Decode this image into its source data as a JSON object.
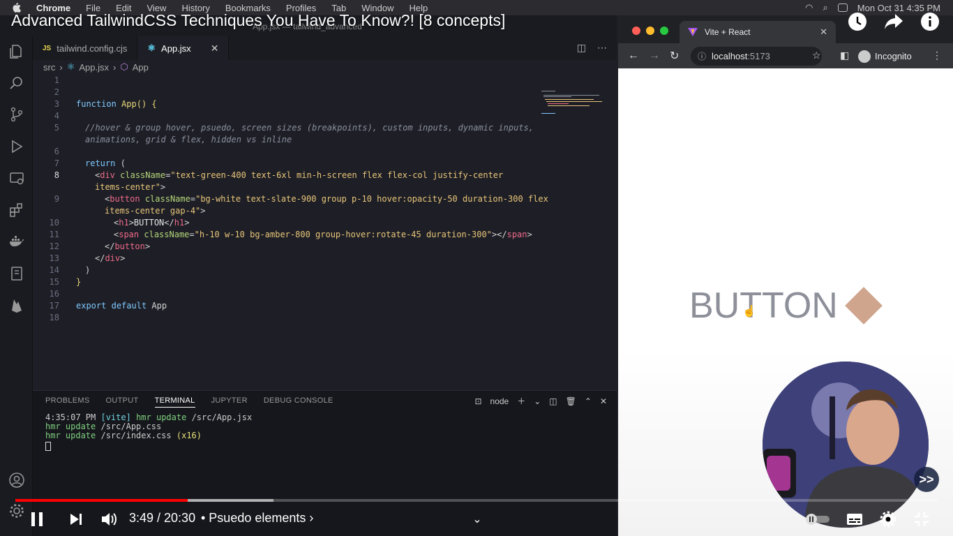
{
  "menubar": {
    "app": "Chrome",
    "items": [
      "File",
      "Edit",
      "View",
      "History",
      "Bookmarks",
      "Profiles",
      "Tab",
      "Window",
      "Help"
    ],
    "clock": "Mon Oct 31  4:35 PM"
  },
  "video": {
    "title": "Advanced TailwindCSS Techniques You Have To Know?! [8 concepts]",
    "time": "3:49 / 20:30",
    "chapter": "• Psuedo elements ›",
    "progress_played": 0.187,
    "progress_buffered": 0.28,
    "skip_label": ">>"
  },
  "vscode": {
    "window_title": "App.jsx — tailwind_advanced",
    "tabs": [
      {
        "label": "tailwind.config.cjs",
        "icon": "JS"
      },
      {
        "label": "App.jsx",
        "icon": "⚛"
      }
    ],
    "breadcrumb": {
      "src": "src",
      "file": "App.jsx",
      "symbol": "App"
    },
    "line_numbers": [
      "1",
      "2",
      "3",
      "4",
      "5",
      "",
      "6",
      "7",
      "8",
      "",
      "9",
      "",
      "10",
      "11",
      "12",
      "13",
      "14",
      "15",
      "16",
      "17",
      "18"
    ],
    "panel_tabs": [
      "PROBLEMS",
      "OUTPUT",
      "TERMINAL",
      "JUPYTER",
      "DEBUG CONSOLE"
    ],
    "panel_shell": "node",
    "terminal": {
      "line1_time": "4:35:07 PM",
      "line1_tag": "[vite]",
      "line1_msg": "hmr update",
      "line1_path": "/src/App.jsx",
      "line2_msg": "hmr update",
      "line2_path": "/src/App.css",
      "line3_msg": "hmr update",
      "line3_path": "/src/index.css",
      "line3_count": "(x16)"
    }
  },
  "code": {
    "l3_kw": "function",
    "l3_fn": "App",
    "l3_rest": "() {",
    "l5a": "//hover & group hover, psuedo, screen sizes (breakpoints), custom inputs, dynamic inputs,",
    "l5b": "animations, grid & flex, hidden vs inline",
    "l7_kw": "return",
    "l7_rest": " (",
    "l8_tag": "div",
    "l8_attr": "className",
    "l8_str": "\"text-green-400 text-6xl min-h-screen flex flex-col justify-center",
    "l8b_str": "items-center\"",
    "l9_tag": "button",
    "l9_attr": "className",
    "l9_str": "\"bg-white text-slate-900 group p-10 hover:opacity-50 duration-300 flex",
    "l9b_str": "items-center gap-4\"",
    "l10_tag": "h1",
    "l10_text": "BUTTON",
    "l11_tag": "span",
    "l11_attr": "className",
    "l11_str": "\"h-10 w-10 bg-amber-800 group-hover:rotate-45 duration-300\"",
    "l12_tag": "button",
    "l13_tag": "div",
    "l14": ")",
    "l15": "}",
    "l17_kw1": "export",
    "l17_kw2": "default",
    "l17_fn": "App"
  },
  "chrome": {
    "tab_title": "Vite + React",
    "url_host": "localhost",
    "url_port": ":5173",
    "profile": "Incognito"
  },
  "app_page": {
    "button_text": "BUTTON",
    "square_color": "#cfa58e",
    "text_color": "#8d8f99"
  },
  "colors": {
    "progress_red": "#ff0000",
    "editor_bg": "#1e1f26"
  }
}
